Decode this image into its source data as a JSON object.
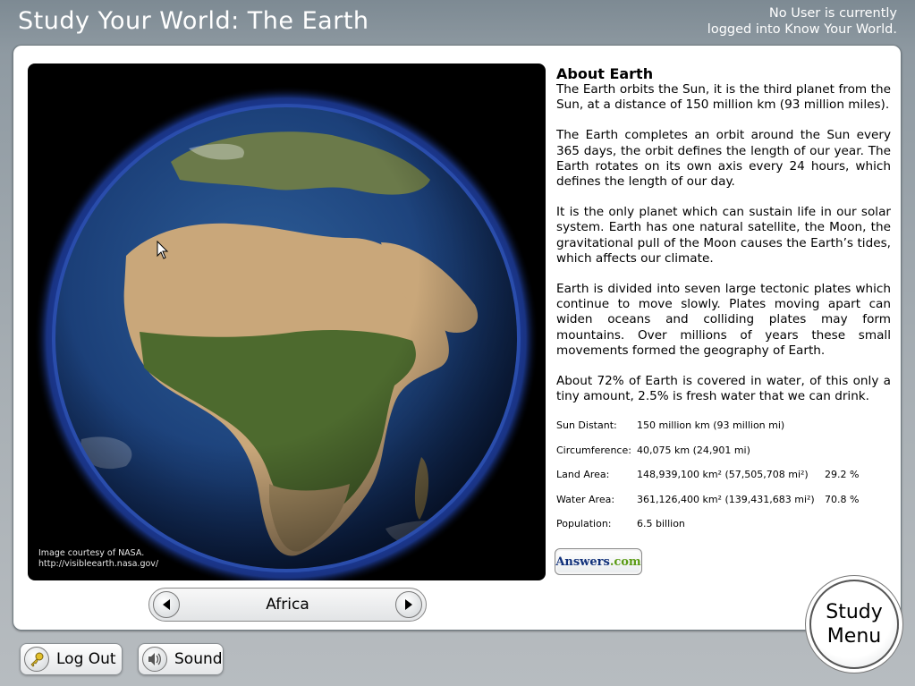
{
  "header": {
    "title": "Study Your World: The Earth",
    "user_status_line1": "No User is currently",
    "user_status_line2": "logged into Know Your World."
  },
  "image": {
    "credit_line1": "Image courtesy of NASA.",
    "credit_line2": "http://visibleearth.nasa.gov/"
  },
  "about": {
    "heading": "About Earth",
    "paragraphs": [
      "The Earth orbits the Sun, it is the third planet from the Sun, at a distance of 150 million km (93 million miles).",
      "The Earth completes an orbit around the Sun every 365 days, the orbit defines the length of our year. The Earth rotates on its own axis every 24 hours, which defines the length of our day.",
      "It is the only planet which can sustain life in our solar system. Earth has one natural satellite, the Moon, the gravitational pull of the Moon causes the Earth’s tides, which affects our climate.",
      "Earth is divided into seven large tectonic plates which continue to move slowly. Plates moving apart can widen oceans and colliding plates may form mountains. Over millions of years these small movements formed the geography of Earth.",
      "About 72% of Earth is covered in water, of this only a tiny amount, 2.5% is fresh water that we can drink."
    ]
  },
  "stats": [
    {
      "label": "Sun Distant:",
      "value": "150 million km (93 million mi)",
      "pct": ""
    },
    {
      "label": "Circumference:",
      "value": "40,075 km (24,901 mi)",
      "pct": ""
    },
    {
      "label": "Land Area:",
      "value": "148,939,100 km² (57,505,708 mi²)",
      "pct": "29.2 %"
    },
    {
      "label": "Water Area:",
      "value": "361,126,400 km² (139,431,683 mi²)",
      "pct": "70.8 %"
    },
    {
      "label": "Population:",
      "value": "6.5 billion",
      "pct": ""
    }
  ],
  "answers_button": {
    "part1": "Answers",
    "part2": ".com"
  },
  "region_nav": {
    "current": "Africa"
  },
  "footer": {
    "logout_label": "Log Out",
    "sound_label": "Sound",
    "study_menu_line1": "Study",
    "study_menu_line2": "Menu"
  },
  "colors": {
    "accent_answers": "#10307a",
    "accent_com": "#5b9b14"
  }
}
